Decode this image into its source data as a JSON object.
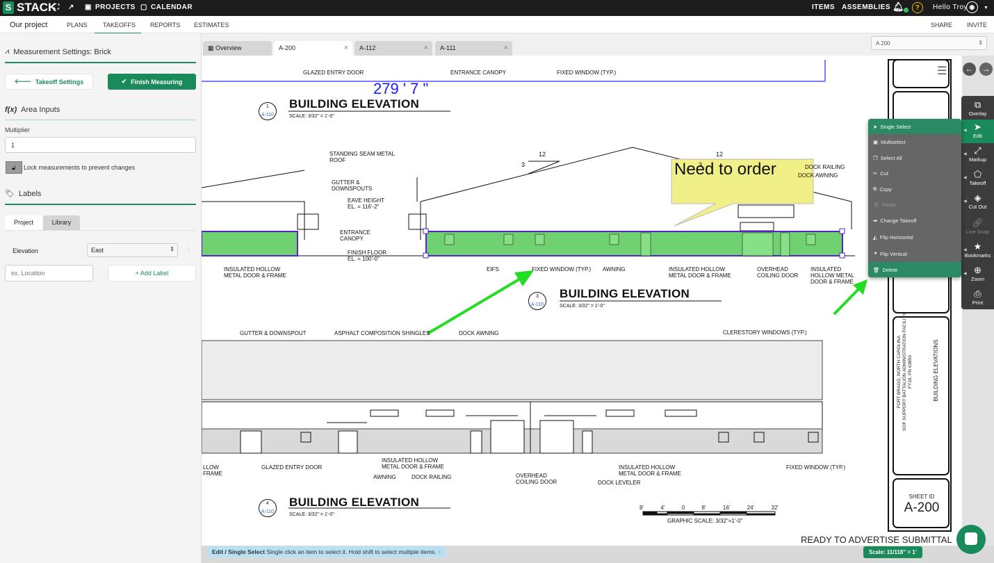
{
  "topbar": {
    "brand": "STACK",
    "projects": "PROJECTS",
    "calendar": "CALENDAR",
    "items": "ITEMS",
    "assemblies": "ASSEMBLIES",
    "greeting": "Hello Troy",
    "help": "?"
  },
  "nav": {
    "project_name": "Our project",
    "tabs": [
      "PLANS",
      "TAKEOFFS",
      "REPORTS",
      "ESTIMATES"
    ],
    "active_tab": "TAKEOFFS",
    "share": "SHARE",
    "invite": "INVITE"
  },
  "left": {
    "measurement_title": "Measurement Settings: Brick",
    "takeoff_settings": "Takeoff Settings",
    "finish_measuring": "Finish Measuring",
    "area_inputs": "Area Inputs",
    "multiplier_label": "Multiplier",
    "multiplier_value": "1",
    "lock_text": "Lock measurements to prevent changes",
    "labels_title": "Labels",
    "label_tabs": [
      "Project",
      "Library"
    ],
    "elevation_label": "Elevation",
    "elevation_value": "East",
    "location_placeholder": "ex. Location",
    "add_label": "+ Add Label"
  },
  "sheet_tabs": [
    {
      "label": "Overview"
    },
    {
      "label": "A-200",
      "active": true
    },
    {
      "label": "A-112"
    },
    {
      "label": "A-111"
    }
  ],
  "sheet_select": "A 200",
  "drawing": {
    "measurement": "279 ' 7 \"",
    "note": "Need to order",
    "elevations": [
      {
        "num": "1",
        "ref": "A-110",
        "title": "BUILDING ELEVATION",
        "scale": "SCALE: 3/32\" = 1'-0\""
      },
      {
        "num": "3",
        "ref": "A-110",
        "title": "BUILDING ELEVATION",
        "scale": "SCALE: 3/32\" = 1'-0\""
      },
      {
        "num": "4",
        "ref": "A-110",
        "title": "BUILDING ELEVATION",
        "scale": "SCALE: 3/32\" = 1'-0\""
      }
    ],
    "labels": [
      "GLAZED ENTRY DOOR",
      "ENTRANCE CANOPY",
      "FIXED WINDOW (TYP.)",
      "STANDING SEAM METAL\nROOF",
      "GUTTER &\nDOWNSPOUTS",
      "EAVE HEIGHT\nEL. = 116'-2\"",
      "ENTRANCE\nCANOPY",
      "FINISH FLOOR\nEL. = 100'-0\"",
      "INSULATED HOLLOW\nMETAL DOOR & FRAME",
      "EIFS",
      "FIXED WINDOW (TYP.)",
      "AWNING",
      "INSULATED HOLLOW\nMETAL DOOR & FRAME",
      "OVERHEAD\nCOILING DOOR",
      "INSULATED\nHOLLOW METAL\nDOOR & FRAME",
      "DOCK RAILING",
      "DOCK AWNING",
      "12",
      "3",
      "12",
      "3",
      "GUTTER & DOWNSPOUT",
      "ASPHALT COMPOSITION SHINGLES",
      "DOCK AWNING",
      "CLERESTORY WINDOWS (TYP.)",
      "LLOW\nFRAME",
      "GLAZED ENTRY DOOR",
      "INSULATED HOLLOW\nMETAL DOOR & FRAME",
      "AWNING",
      "DOCK RAILING",
      "OVERHEAD\nCOILING DOOR",
      "INSULATED HOLLOW\nMETAL DOOR & FRAME",
      "DOCK LEVELER",
      "FIXED WINDOW (TYP.)"
    ],
    "graphic_scale_ticks": [
      "8'",
      "4'",
      "0",
      "8'",
      "16'",
      "24'",
      "32'"
    ],
    "graphic_scale_label": "GRAPHIC SCALE: 3/32\"=1'-0\"",
    "submittal": "READY TO ADVERTISE SUBMITTAL",
    "titleblock": {
      "project": "FORT BRAGG, NORTH CAROLINA\nSOF SUPPORT BATTALION ADMINISTRATION FACILITY\nFY18, PN 63850",
      "sheet_title": "BUILDING ELEVATIONS",
      "sheet_id_label": "SHEET ID",
      "sheet_id": "A-200"
    },
    "arrow_color": "#22dd22",
    "highlight_color": "#3fc23f",
    "selection_color": "#5522cc"
  },
  "tools": [
    "Overlay",
    "Edit",
    "Markup",
    "Takeoff",
    "Cut Out",
    "Line Snap",
    "Bookmarks",
    "Zoom",
    "Print"
  ],
  "edit_menu": [
    "Single Select",
    "Multiselect",
    "Select All",
    "Cut",
    "Copy",
    "Paste",
    "Change Takeoff",
    "Flip Horizontal",
    "Flip Vertical",
    "Delete"
  ],
  "hint": {
    "mode": "Edit / Single Select",
    "text": "Single click an item to select it. Hold shift to select multiple items."
  },
  "scale_badge": "Scale: 11/118\" = 1'",
  "colors": {
    "brand": "#1a8a5a",
    "topbar": "#1c1c1c",
    "menu": "#666666"
  }
}
